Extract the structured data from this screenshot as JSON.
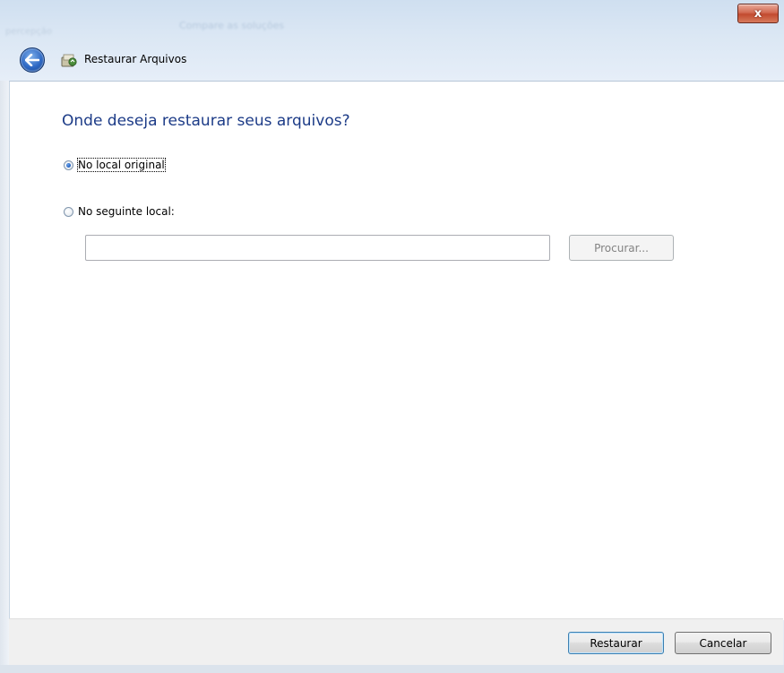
{
  "window": {
    "title_blurred": "Compare as soluções",
    "left_blurred": "percepção",
    "close_symbol": "x"
  },
  "header": {
    "title": "Restaurar Arquivos",
    "back_icon": "back-arrow-icon",
    "app_icon": "restore-files-icon"
  },
  "main": {
    "heading": "Onde deseja restaurar seus arquivos?",
    "options": [
      {
        "label": "No local original",
        "checked": true
      },
      {
        "label": "No seguinte local:",
        "checked": false
      }
    ],
    "path_input_value": "",
    "browse_label": "Procurar..."
  },
  "footer": {
    "restore_label": "Restaurar",
    "cancel_label": "Cancelar"
  },
  "colors": {
    "heading": "#1c3b87",
    "close_button": "#c24a2e",
    "back_button": "#2d68c4"
  }
}
